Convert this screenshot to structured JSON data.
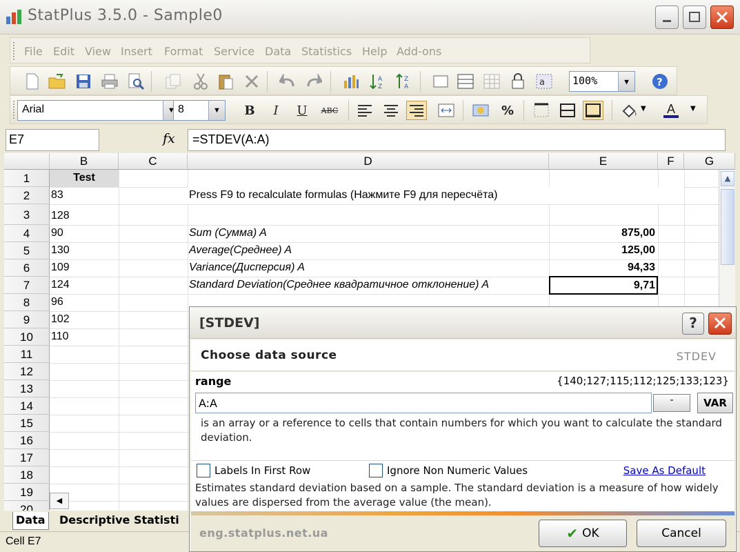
{
  "window": {
    "title": "StatPlus 3.5.0 - Sample0"
  },
  "menu": [
    "File",
    "Edit",
    "View",
    "Insert",
    "Format",
    "Service",
    "Data",
    "Statistics",
    "Help",
    "Add-ons"
  ],
  "toolbar": {
    "zoom": "100%",
    "font_name": "Arial",
    "font_size": "8",
    "bold": "B",
    "italic": "I",
    "underline": "U",
    "strike": "ABC",
    "percent": "%",
    "font_color": "A"
  },
  "formula_bar": {
    "cell_ref": "E7",
    "fx": "fx",
    "formula": "=STDEV(A:A)"
  },
  "grid": {
    "columns": [
      "B",
      "C",
      "D",
      "E",
      "F",
      "G"
    ],
    "rows": [
      "1",
      "2",
      "3",
      "4",
      "5",
      "6",
      "7",
      "8",
      "9",
      "10",
      "11",
      "12",
      "13",
      "14",
      "15",
      "16",
      "17",
      "18",
      "19",
      "20"
    ],
    "col_b": [
      "Test",
      "83",
      "128",
      "90",
      "130",
      "109",
      "124",
      "96",
      "102",
      "110"
    ],
    "d2": "Press F9 to recalculate formulas (Нажмите F9 для пересчёта)",
    "stats": [
      {
        "label": "Sum (Сумма) A",
        "value": "875,00"
      },
      {
        "label": "Average(Среднее) A",
        "value": "125,00"
      },
      {
        "label": "Variance(Дисперсия) A",
        "value": "94,33"
      },
      {
        "label": "Standard Deviation(Среднее квадратичное отклонение) A",
        "value": "9,71"
      }
    ]
  },
  "sheets": {
    "active": "Data",
    "second": "Descriptive Statisti"
  },
  "status": "Cell E7",
  "dialog": {
    "title": "[STDEV]",
    "help": "?",
    "header": "Choose data source",
    "function": "STDEV",
    "range_label": "range",
    "range_preview": "{140;127;115;112;125;133;123}",
    "range_value": "A:A",
    "pick_label": "- ",
    "var_label": "VAR",
    "range_description": "is an array or a reference to cells that contain numbers for which you want to calculate the standard deviation.",
    "labels_first_row": "Labels In First Row",
    "ignore_non_numeric": "Ignore Non Numeric Values",
    "save_default": "Save As Default",
    "function_description": "Estimates standard deviation based on a sample. The standard deviation is a measure of how widely values are dispersed from the average value (the mean).",
    "site": "eng.statplus.net.ua",
    "ok": "OK",
    "cancel": "Cancel"
  }
}
